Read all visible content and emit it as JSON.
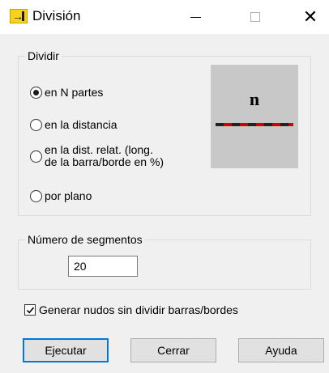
{
  "window": {
    "title": "División",
    "icon": "split-bar-icon",
    "minimize_icon": "minimize-icon",
    "maximize_icon": "maximize-icon",
    "close_icon": "close-icon",
    "close_glyph": "✕"
  },
  "divide_group": {
    "legend": "Dividir",
    "options": [
      {
        "label": "en N partes",
        "selected": true
      },
      {
        "label": "en la distancia",
        "selected": false
      },
      {
        "label_line1": "en la dist. relat. (long.",
        "label_line2": "de la barra/borde en %)",
        "selected": false
      },
      {
        "label": "por plano",
        "selected": false
      }
    ],
    "preview": {
      "symbol": "n",
      "line_colors": [
        "#222222",
        "#d20000"
      ]
    }
  },
  "segments_group": {
    "legend": "Número de segmentos",
    "value": "20"
  },
  "checkbox": {
    "label": "Generar nudos sin dividir barras/bordes",
    "checked": true
  },
  "buttons": {
    "execute": "Ejecutar",
    "close": "Cerrar",
    "help": "Ayuda"
  },
  "colors": {
    "focus_border": "#0078d7",
    "dialog_bg": "#f0f0f0"
  }
}
